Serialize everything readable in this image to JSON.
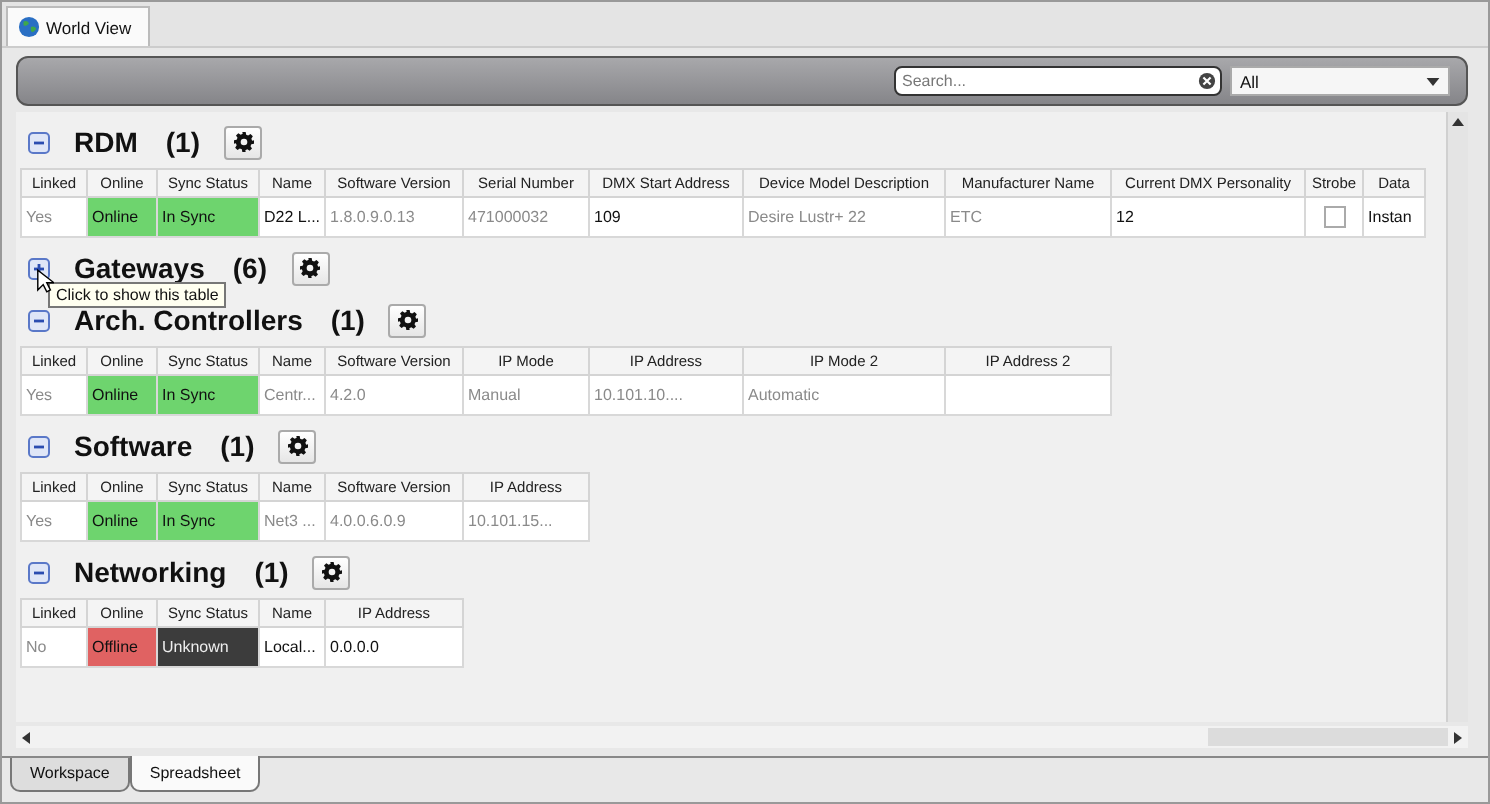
{
  "top_tabs": [
    {
      "label": "World View",
      "selected": true
    }
  ],
  "toolbar": {
    "search": {
      "placeholder": "Search..."
    },
    "filter": {
      "value": "All"
    }
  },
  "sections": [
    {
      "title": "RDM",
      "count": "(1)",
      "expanded": true,
      "columns": [
        "Linked",
        "Online",
        "Sync Status",
        "Name",
        "Software Version",
        "Serial Number",
        "DMX Start Address",
        "Device Model Description",
        "Manufacturer Name",
        "Current DMX Personality",
        "Strobe",
        "Data"
      ],
      "rows": [
        [
          {
            "kind": "text",
            "text": "Yes",
            "dim": true
          },
          {
            "kind": "text",
            "text": "Online",
            "dim": false,
            "color": "#6ed46e"
          },
          {
            "kind": "text",
            "text": "In Sync",
            "dim": false,
            "color": "#6ed46e"
          },
          {
            "kind": "text",
            "text": "D22 L...",
            "dim": false
          },
          {
            "kind": "text",
            "text": "1.8.0.9.0.13",
            "dim": true
          },
          {
            "kind": "text",
            "text": "471000032",
            "dim": true
          },
          {
            "kind": "text",
            "text": "109",
            "dim": false
          },
          {
            "kind": "text",
            "text": "Desire Lustr+ 22",
            "dim": true
          },
          {
            "kind": "text",
            "text": "ETC",
            "dim": true
          },
          {
            "kind": "text",
            "text": "12",
            "dim": false
          },
          {
            "kind": "checkbox",
            "checked": false
          },
          {
            "kind": "text",
            "text": "Instan",
            "dim": false
          }
        ]
      ]
    },
    {
      "title": "Gateways",
      "count": "(6)",
      "expanded": false,
      "tooltip": "Click to show this table"
    },
    {
      "title": "Arch. Controllers",
      "count": "(1)",
      "expanded": true,
      "columns": [
        "Linked",
        "Online",
        "Sync Status",
        "Name",
        "Software Version",
        "IP Mode",
        "IP Address",
        "IP Mode 2",
        "IP Address 2"
      ],
      "rows": [
        [
          {
            "kind": "text",
            "text": "Yes",
            "dim": true
          },
          {
            "kind": "text",
            "text": "Online",
            "dim": false,
            "color": "#6ed46e"
          },
          {
            "kind": "text",
            "text": "In Sync",
            "dim": false,
            "color": "#6ed46e"
          },
          {
            "kind": "text",
            "text": "Centr...",
            "dim": true
          },
          {
            "kind": "text",
            "text": "4.2.0",
            "dim": true
          },
          {
            "kind": "text",
            "text": "Manual",
            "dim": true
          },
          {
            "kind": "text",
            "text": "10.101.10....",
            "dim": true
          },
          {
            "kind": "text",
            "text": "Automatic",
            "dim": true
          },
          {
            "kind": "empty"
          }
        ]
      ]
    },
    {
      "title": "Software",
      "count": "(1)",
      "expanded": true,
      "columns": [
        "Linked",
        "Online",
        "Sync Status",
        "Name",
        "Software Version",
        "IP Address"
      ],
      "rows": [
        [
          {
            "kind": "text",
            "text": "Yes",
            "dim": true
          },
          {
            "kind": "text",
            "text": "Online",
            "dim": false,
            "color": "#6ed46e"
          },
          {
            "kind": "text",
            "text": "In Sync",
            "dim": false,
            "color": "#6ed46e"
          },
          {
            "kind": "text",
            "text": "Net3 ...",
            "dim": true
          },
          {
            "kind": "text",
            "text": "4.0.0.6.0.9",
            "dim": true
          },
          {
            "kind": "text",
            "text": "10.101.15...",
            "dim": true
          }
        ]
      ]
    },
    {
      "title": "Networking",
      "count": "(1)",
      "expanded": true,
      "columns": [
        "Linked",
        "Online",
        "Sync Status",
        "Name",
        "IP Address"
      ],
      "rows": [
        [
          {
            "kind": "text",
            "text": "No",
            "dim": true
          },
          {
            "kind": "text",
            "text": "Offline",
            "dim": false,
            "color": "#e06262"
          },
          {
            "kind": "text",
            "text": "Unknown",
            "dim": false,
            "color": "#3c3c3c"
          },
          {
            "kind": "text",
            "text": "Local...",
            "dim": false
          },
          {
            "kind": "text",
            "text": "0.0.0.0",
            "dim": false
          }
        ]
      ]
    }
  ],
  "bottom_tabs": [
    {
      "label": "Workspace",
      "selected": false
    },
    {
      "label": "Spreadsheet",
      "selected": true
    }
  ]
}
